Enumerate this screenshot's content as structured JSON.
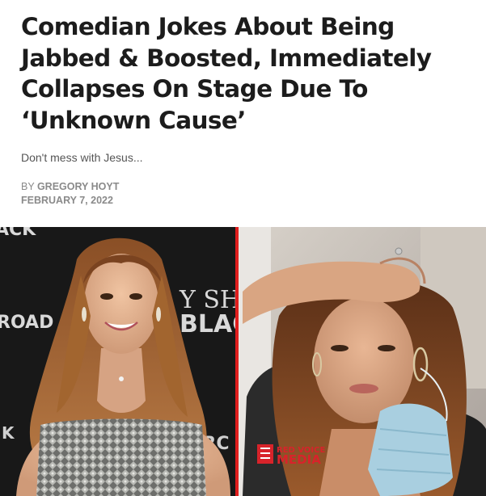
{
  "article": {
    "headline_lines": [
      "Comedian Jokes About Being",
      "Jabbed & Boosted, Immediately",
      "Collapses On Stage Due To",
      "‘Unknown Cause’"
    ],
    "dek": "Don't mess with Jesus...",
    "byline_prefix": "BY",
    "author": "GREGORY HOYT",
    "date": "FEBRUARY 7, 2022"
  },
  "hero_image": {
    "left_backdrop_text": [
      "ACK",
      "Y SH",
      "ROAD",
      "BLACI",
      "K",
      "NRC"
    ],
    "watermark_line1": "RED VOICE",
    "watermark_line2": "MEDIA",
    "divider_color": "#e01e1e",
    "watermark_color": "#d8232a"
  }
}
